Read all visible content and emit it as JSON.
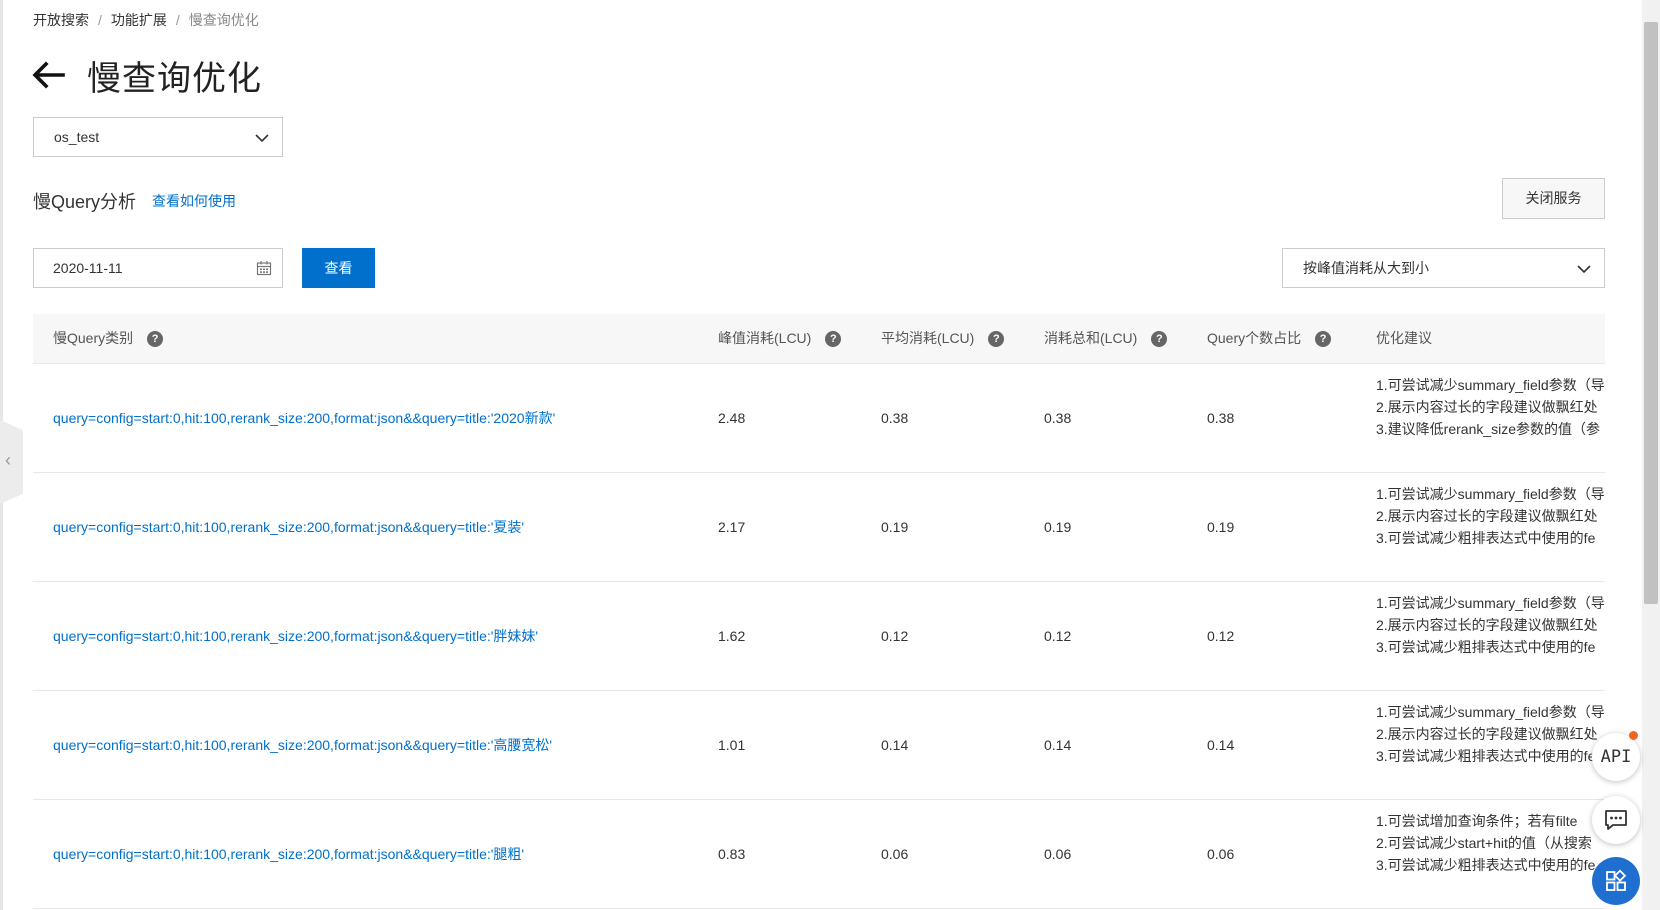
{
  "breadcrumb": [
    "开放搜索",
    "功能扩展",
    "慢查询优化"
  ],
  "page_title": "慢查询优化",
  "app_select": {
    "value": "os_test"
  },
  "section": {
    "title": "慢Query分析",
    "help_link": "查看如何使用",
    "close_button": "关闭服务"
  },
  "filter": {
    "date": "2020-11-11",
    "query_button": "查看",
    "sort": "按峰值消耗从大到小"
  },
  "table": {
    "columns": [
      "慢Query类别",
      "峰值消耗(LCU)",
      "平均消耗(LCU)",
      "消耗总和(LCU)",
      "Query个数占比",
      "优化建议"
    ],
    "rows": [
      {
        "query": "query=config=start:0,hit:100,rerank_size:200,format:json&&query=title:'2020新款'",
        "peak": "2.48",
        "avg": "0.38",
        "total": "0.38",
        "ratio": "0.38",
        "suggestions": [
          "1.可尝试减少summary_field参数（导",
          "2.展示内容过长的字段建议做飘红处",
          "3.建议降低rerank_size参数的值（参"
        ]
      },
      {
        "query": "query=config=start:0,hit:100,rerank_size:200,format:json&&query=title:'夏装'",
        "peak": "2.17",
        "avg": "0.19",
        "total": "0.19",
        "ratio": "0.19",
        "suggestions": [
          "1.可尝试减少summary_field参数（导",
          "2.展示内容过长的字段建议做飘红处",
          "3.可尝试减少粗排表达式中使用的fe"
        ]
      },
      {
        "query": "query=config=start:0,hit:100,rerank_size:200,format:json&&query=title:'胖妹妹'",
        "peak": "1.62",
        "avg": "0.12",
        "total": "0.12",
        "ratio": "0.12",
        "suggestions": [
          "1.可尝试减少summary_field参数（导",
          "2.展示内容过长的字段建议做飘红处",
          "3.可尝试减少粗排表达式中使用的fe"
        ]
      },
      {
        "query": "query=config=start:0,hit:100,rerank_size:200,format:json&&query=title:'高腰宽松'",
        "peak": "1.01",
        "avg": "0.14",
        "total": "0.14",
        "ratio": "0.14",
        "suggestions": [
          "1.可尝试减少summary_field参数（导",
          "2.展示内容过长的字段建议做飘红处",
          "3.可尝试减少粗排表达式中使用的fe"
        ]
      },
      {
        "query": "query=config=start:0,hit:100,rerank_size:200,format:json&&query=title:'腿粗'",
        "peak": "0.83",
        "avg": "0.06",
        "total": "0.06",
        "ratio": "0.06",
        "suggestions": [
          "1.可尝试增加查询条件；若有filte",
          "2.可尝试减少start+hit的值（从搜索",
          "3.可尝试减少粗排表达式中使用的fe"
        ]
      }
    ]
  },
  "floating": {
    "api_label": "API",
    "icons": [
      "api-icon",
      "feedback-icon",
      "apps-icon"
    ],
    "notify_color": "#f5641e"
  },
  "colors": {
    "primary": "#0070cc",
    "link": "#0070cc"
  }
}
